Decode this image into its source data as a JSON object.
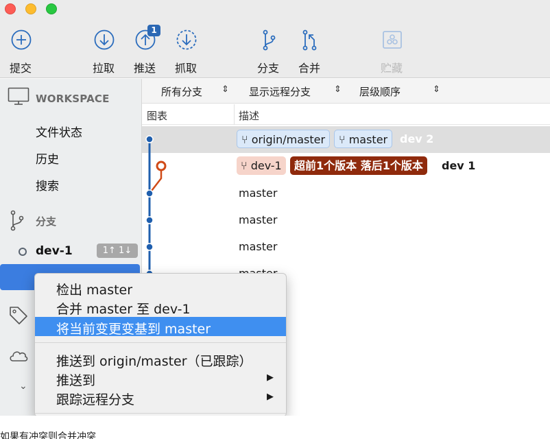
{
  "toolbar": {
    "buttons": [
      {
        "label": "提交",
        "icon": "commit-icon"
      },
      {
        "label": "拉取",
        "icon": "pull-icon"
      },
      {
        "label": "推送",
        "icon": "push-icon"
      },
      {
        "label": "抓取",
        "icon": "fetch-icon"
      },
      {
        "label": "分支",
        "icon": "branch-icon"
      },
      {
        "label": "合并",
        "icon": "merge-icon"
      },
      {
        "label": "贮藏",
        "icon": "stash-icon"
      }
    ],
    "push_badge": "1"
  },
  "sidebar": {
    "workspace_label": "WORKSPACE",
    "items": [
      "文件状态",
      "历史",
      "搜索"
    ],
    "branches_label": "分支",
    "current_branch": "dev-1",
    "current_branch_badge": "1↑ 1↓"
  },
  "filters": {
    "all_branches": "所有分支",
    "show_remote": "显示远程分支",
    "order": "层级顺序"
  },
  "columns": {
    "graph": "图表",
    "description": "描述"
  },
  "rows": [
    {
      "refs": [
        "origin/master",
        "master"
      ],
      "message": "dev 2"
    },
    {
      "refs": [
        "dev-1"
      ],
      "status": "超前1个版本 落后1个版本",
      "message": "dev 1"
    },
    {
      "message": "master"
    },
    {
      "message": "master"
    },
    {
      "message": "master"
    },
    {
      "message": "master"
    }
  ],
  "context_menu": {
    "items": [
      {
        "label": "检出 master"
      },
      {
        "label": "合并 master 至 dev-1"
      },
      {
        "label": "将当前变更变基到 master",
        "selected": true
      },
      {
        "label": "推送到 origin/master（已跟踪）"
      },
      {
        "label": "推送到",
        "submenu": true
      },
      {
        "label": "跟踪远程分支",
        "submenu": true
      }
    ]
  },
  "colors": {
    "graph_blue": "#1f5fae",
    "graph_orange": "#d04a17",
    "selection": "#3f8ff0"
  },
  "caption": "如果有冲突则合并冲突"
}
